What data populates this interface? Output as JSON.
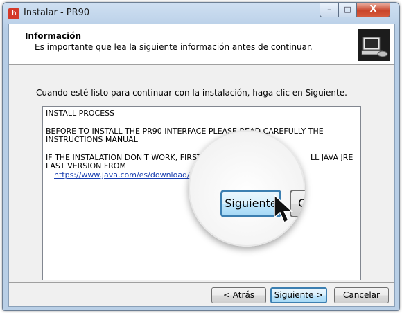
{
  "window": {
    "title": "Instalar - PR90",
    "app_icon": "pr90-app-icon",
    "minimize": "–",
    "maximize": "□",
    "close": "X"
  },
  "header": {
    "title": "Información",
    "subtitle": "Es importante que lea la siguiente información antes de continuar.",
    "logo": "installer-computer-icon"
  },
  "body": {
    "intro": "Cuando esté listo para continuar con la instalación, haga clic en Siguiente.",
    "memo": {
      "line1": "INSTALL PROCESS",
      "line2": "BEFORE TO INSTALL THE PR90 INTERFACE PLEASE READ CAREFULLY THE",
      "line3": "INSTRUCTIONS MANUAL",
      "line4": "IF THE INSTALATION DON'T WORK, FIRST",
      "line4b": "LL JAVA JRE",
      "line5": "LAST VERSION FROM",
      "link": "https://www.java.com/es/download/"
    }
  },
  "buttons": {
    "back": "< Atrás",
    "next": "Siguiente >",
    "cancel": "Cancelar"
  },
  "magnifier": {
    "button_label": "Siguiente",
    "second_button_label": "C"
  },
  "colors": {
    "accent": "#3c7fb1",
    "close_red": "#c9442a",
    "link": "#1a3fb0"
  }
}
